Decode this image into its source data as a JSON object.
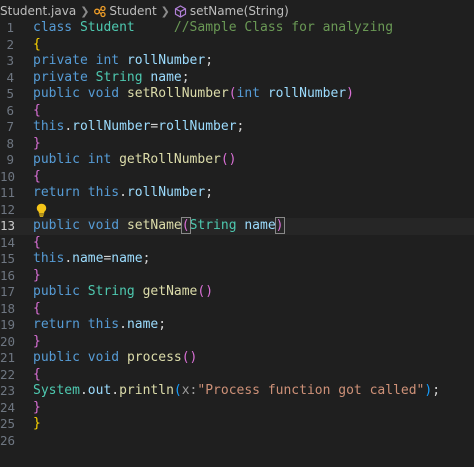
{
  "breadcrumb": {
    "file": "Student.java",
    "class_name": "Student",
    "method": "setName(String)",
    "icons": [
      "java-file-icon",
      "class-icon",
      "method-icon"
    ]
  },
  "editor": {
    "active_line": "13",
    "lines": [
      {
        "n": "1",
        "tokens": [
          {
            "t": "class ",
            "c": "kw"
          },
          {
            "t": "Student",
            "c": "cls"
          },
          {
            "t": "     ",
            "c": "pl"
          },
          {
            "t": "//Sample Class for analyzing",
            "c": "cmt"
          }
        ]
      },
      {
        "n": "2",
        "tokens": [
          {
            "t": "{",
            "c": "br1"
          }
        ]
      },
      {
        "n": "3",
        "tokens": [
          {
            "t": "private ",
            "c": "kw"
          },
          {
            "t": "int ",
            "c": "kw"
          },
          {
            "t": "rollNumber",
            "c": "var"
          },
          {
            "t": ";",
            "c": "pl"
          }
        ]
      },
      {
        "n": "4",
        "tokens": [
          {
            "t": "private ",
            "c": "kw"
          },
          {
            "t": "String ",
            "c": "cls"
          },
          {
            "t": "name",
            "c": "var"
          },
          {
            "t": ";",
            "c": "pl"
          }
        ]
      },
      {
        "n": "5",
        "tokens": [
          {
            "t": "public ",
            "c": "kw"
          },
          {
            "t": "void ",
            "c": "kw"
          },
          {
            "t": "setRollNumber",
            "c": "fn"
          },
          {
            "t": "(",
            "c": "br2"
          },
          {
            "t": "int ",
            "c": "kw"
          },
          {
            "t": "rollNumber",
            "c": "var"
          },
          {
            "t": ")",
            "c": "br2"
          }
        ]
      },
      {
        "n": "6",
        "tokens": [
          {
            "t": "{",
            "c": "br2"
          }
        ]
      },
      {
        "n": "7",
        "tokens": [
          {
            "t": "this",
            "c": "kw"
          },
          {
            "t": ".",
            "c": "pl"
          },
          {
            "t": "rollNumber",
            "c": "var"
          },
          {
            "t": "=",
            "c": "pl"
          },
          {
            "t": "rollNumber",
            "c": "var"
          },
          {
            "t": ";",
            "c": "pl"
          }
        ]
      },
      {
        "n": "8",
        "tokens": [
          {
            "t": "}",
            "c": "br2"
          }
        ]
      },
      {
        "n": "9",
        "tokens": [
          {
            "t": "public ",
            "c": "kw"
          },
          {
            "t": "int ",
            "c": "kw"
          },
          {
            "t": "getRollNumber",
            "c": "fn"
          },
          {
            "t": "()",
            "c": "br2"
          }
        ]
      },
      {
        "n": "10",
        "tokens": [
          {
            "t": "{",
            "c": "br2"
          }
        ]
      },
      {
        "n": "11",
        "tokens": [
          {
            "t": "return ",
            "c": "kw"
          },
          {
            "t": "this",
            "c": "kw"
          },
          {
            "t": ".",
            "c": "pl"
          },
          {
            "t": "rollNumber",
            "c": "var"
          },
          {
            "t": ";",
            "c": "pl"
          }
        ]
      },
      {
        "n": "12",
        "tokens": [],
        "bulb": true
      },
      {
        "n": "13",
        "tokens": [
          {
            "t": "public ",
            "c": "kw"
          },
          {
            "t": "void ",
            "c": "kw"
          },
          {
            "t": "setName",
            "c": "fn"
          },
          {
            "t": "(",
            "c": "br2 bm"
          },
          {
            "t": "String ",
            "c": "cls"
          },
          {
            "t": "name",
            "c": "var"
          },
          {
            "t": ")",
            "c": "br2 bm"
          }
        ]
      },
      {
        "n": "14",
        "tokens": [
          {
            "t": "{",
            "c": "br2"
          }
        ]
      },
      {
        "n": "15",
        "tokens": [
          {
            "t": "this",
            "c": "kw"
          },
          {
            "t": ".",
            "c": "pl"
          },
          {
            "t": "name",
            "c": "var"
          },
          {
            "t": "=",
            "c": "pl"
          },
          {
            "t": "name",
            "c": "var"
          },
          {
            "t": ";",
            "c": "pl"
          }
        ]
      },
      {
        "n": "16",
        "tokens": [
          {
            "t": "}",
            "c": "br2"
          }
        ]
      },
      {
        "n": "17",
        "tokens": [
          {
            "t": "public ",
            "c": "kw"
          },
          {
            "t": "String ",
            "c": "cls"
          },
          {
            "t": "getName",
            "c": "fn"
          },
          {
            "t": "()",
            "c": "br2"
          }
        ]
      },
      {
        "n": "18",
        "tokens": [
          {
            "t": "{",
            "c": "br2"
          }
        ]
      },
      {
        "n": "19",
        "tokens": [
          {
            "t": "return ",
            "c": "kw"
          },
          {
            "t": "this",
            "c": "kw"
          },
          {
            "t": ".",
            "c": "pl"
          },
          {
            "t": "name",
            "c": "var"
          },
          {
            "t": ";",
            "c": "pl"
          }
        ]
      },
      {
        "n": "20",
        "tokens": [
          {
            "t": "}",
            "c": "br2"
          }
        ]
      },
      {
        "n": "21",
        "tokens": [
          {
            "t": "public ",
            "c": "kw"
          },
          {
            "t": "void ",
            "c": "kw"
          },
          {
            "t": "process",
            "c": "fn"
          },
          {
            "t": "()",
            "c": "br2"
          }
        ]
      },
      {
        "n": "22",
        "tokens": [
          {
            "t": "{",
            "c": "br2"
          }
        ]
      },
      {
        "n": "23",
        "tokens": [
          {
            "t": "System",
            "c": "cls"
          },
          {
            "t": ".",
            "c": "pl"
          },
          {
            "t": "out",
            "c": "var"
          },
          {
            "t": ".",
            "c": "pl"
          },
          {
            "t": "println",
            "c": "fn"
          },
          {
            "t": "(",
            "c": "br3"
          },
          {
            "t": "x:",
            "c": "hint"
          },
          {
            "t": "\"Process function got called\"",
            "c": "str"
          },
          {
            "t": ")",
            "c": "br3"
          },
          {
            "t": ";",
            "c": "pl"
          }
        ]
      },
      {
        "n": "24",
        "tokens": [
          {
            "t": "}",
            "c": "br2"
          }
        ]
      },
      {
        "n": "25",
        "tokens": [
          {
            "t": "}",
            "c": "br1"
          }
        ]
      },
      {
        "n": "26",
        "tokens": []
      }
    ]
  }
}
